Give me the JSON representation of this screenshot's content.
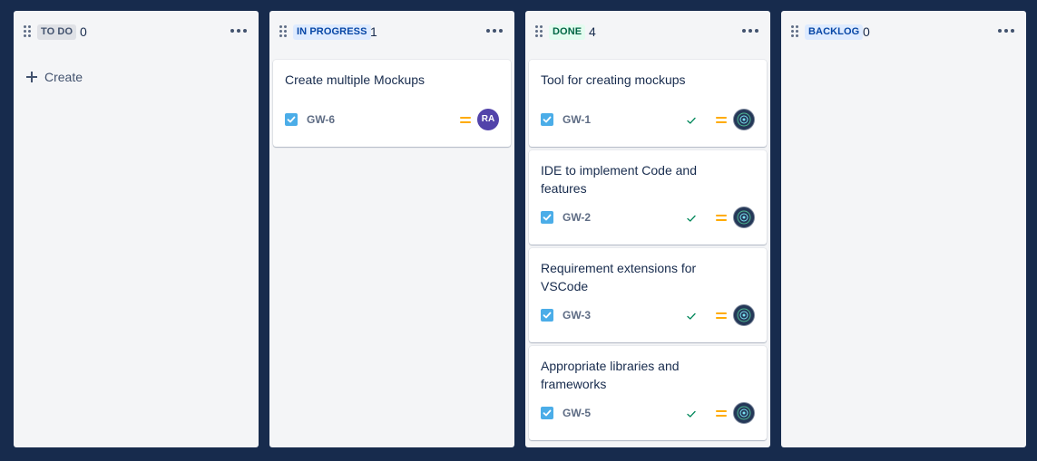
{
  "colors": {
    "background": "#172b4d",
    "column_bg": "#f4f5f7",
    "todo_badge_bg": "#dfe1e6",
    "todo_badge_text": "#42526e",
    "inprogress_badge_bg": "#deebff",
    "inprogress_badge_text": "#0747a6",
    "done_badge_bg": "#e3fcef",
    "done_badge_text": "#006644",
    "backlog_badge_bg": "#deebff",
    "backlog_badge_text": "#0747a6",
    "task_icon": "#4bade8",
    "priority_medium": "#ffab00",
    "done_check": "#00875a",
    "avatar_initials_bg": "#5243aa"
  },
  "columns": [
    {
      "title": "TO DO",
      "count": "0",
      "create_label": "Create",
      "cards": []
    },
    {
      "title": "IN PROGRESS",
      "count": "1",
      "cards": [
        {
          "summary": "Create multiple Mockups",
          "key": "GW-6",
          "type_icon": "checkbox-task-icon",
          "priority_icon": "priority-medium-icon",
          "avatar": "RA",
          "done": false
        }
      ]
    },
    {
      "title": "DONE",
      "count": "4",
      "cards": [
        {
          "summary": "Tool for creating mockups",
          "key": "GW-1",
          "type_icon": "checkbox-task-icon",
          "priority_icon": "priority-medium-icon",
          "avatar_icon": "user-avatar-icon",
          "done": true
        },
        {
          "summary": "IDE to implement Code and features",
          "key": "GW-2",
          "type_icon": "checkbox-task-icon",
          "priority_icon": "priority-medium-icon",
          "avatar_icon": "user-avatar-icon",
          "done": true
        },
        {
          "summary": "Requirement extensions for VSCode",
          "key": "GW-3",
          "type_icon": "checkbox-task-icon",
          "priority_icon": "priority-medium-icon",
          "avatar_icon": "user-avatar-icon",
          "done": true
        },
        {
          "summary": "Appropriate libraries and frameworks",
          "key": "GW-5",
          "type_icon": "checkbox-task-icon",
          "priority_icon": "priority-medium-icon",
          "avatar_icon": "user-avatar-icon",
          "done": true
        }
      ]
    },
    {
      "title": "BACKLOG",
      "count": "0",
      "cards": []
    }
  ]
}
